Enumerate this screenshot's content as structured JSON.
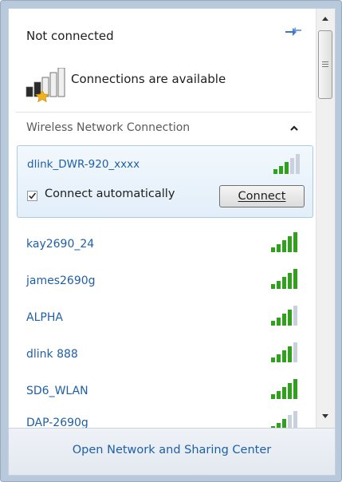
{
  "status": {
    "title": "Not connected",
    "availability_text": "Connections are available"
  },
  "section": {
    "title": "Wireless Network Connection"
  },
  "selected_network": {
    "name": "dlink_DWR-920_xxxx",
    "connect_automatically_label": "Connect automatically",
    "connect_automatically_checked": true,
    "connect_button_label": "Connect"
  },
  "networks": [
    {
      "name": "kay2690_24"
    },
    {
      "name": "james2690g"
    },
    {
      "name": "ALPHA"
    },
    {
      "name": "dlink 888"
    },
    {
      "name": "SD6_WLAN"
    },
    {
      "name": "DAP-2690g"
    }
  ],
  "footer": {
    "link_label": "Open Network and Sharing Center"
  },
  "colors": {
    "link": "#1f5fa6",
    "signal": "#2fa11d",
    "warning_star": "#f2b21a"
  },
  "icons": {
    "refresh": "refresh-icon",
    "availability": "network-available-icon",
    "signal": "signal-strength-icon"
  }
}
